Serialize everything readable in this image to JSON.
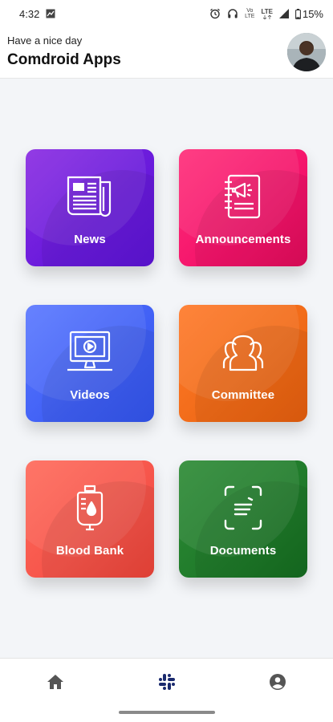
{
  "status_bar": {
    "time": "4:32",
    "network_top": "LTE",
    "network_sub": "Vo\nLTE",
    "battery": "15%",
    "icons": [
      "alarm-icon",
      "headset-icon",
      "volte-icon",
      "lte-icon",
      "signal-icon",
      "battery-icon"
    ]
  },
  "header": {
    "greeting": "Have a nice day",
    "title": "Comdroid Apps"
  },
  "tiles": [
    {
      "label": "News",
      "icon": "newspaper-icon",
      "color": "#6a1bdc"
    },
    {
      "label": "Announcements",
      "icon": "announcement-icon",
      "color": "#f4136a"
    },
    {
      "label": "Videos",
      "icon": "video-monitor-icon",
      "color": "#3f5ff5"
    },
    {
      "label": "Committee",
      "icon": "people-group-icon",
      "color": "#f06a17"
    },
    {
      "label": "Blood Bank",
      "icon": "blood-bag-icon",
      "color": "#f6544a"
    },
    {
      "label": "Documents",
      "icon": "document-scan-icon",
      "color": "#1f7a2a"
    }
  ],
  "bottom_nav": {
    "items": [
      {
        "name": "home",
        "icon": "home-icon",
        "color": "#555555"
      },
      {
        "name": "apps",
        "icon": "slack-hash-icon",
        "color": "#1a2a6e",
        "active": true
      },
      {
        "name": "profile",
        "icon": "account-circle-icon",
        "color": "#555555"
      }
    ]
  }
}
